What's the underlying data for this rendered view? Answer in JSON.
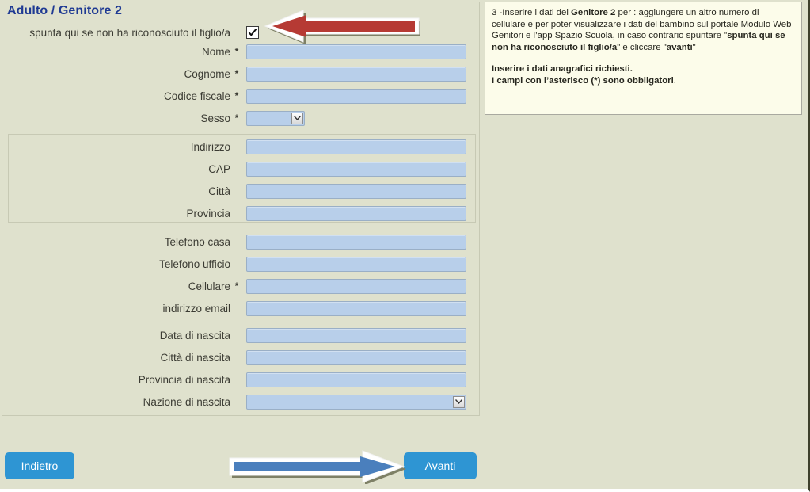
{
  "panel": {
    "title": "Adulto / Genitore 2",
    "checkbox_label": "spunta qui se non ha riconosciuto il figlio/a",
    "checkbox_checked": true,
    "required_marker": "*"
  },
  "fields": [
    {
      "label": "Nome",
      "required": true,
      "type": "text",
      "value": ""
    },
    {
      "label": "Cognome",
      "required": true,
      "type": "text",
      "value": ""
    },
    {
      "label": "Codice fiscale",
      "required": true,
      "type": "text",
      "value": ""
    },
    {
      "label": "Sesso",
      "required": true,
      "type": "select",
      "value": ""
    },
    {
      "label": "Indirizzo",
      "required": false,
      "type": "text",
      "value": ""
    },
    {
      "label": "CAP",
      "required": false,
      "type": "text",
      "value": ""
    },
    {
      "label": "Città",
      "required": false,
      "type": "text",
      "value": ""
    },
    {
      "label": "Provincia",
      "required": false,
      "type": "text",
      "value": ""
    },
    {
      "label": "Telefono casa",
      "required": false,
      "type": "text",
      "value": ""
    },
    {
      "label": "Telefono ufficio",
      "required": false,
      "type": "text",
      "value": ""
    },
    {
      "label": "Cellulare",
      "required": true,
      "type": "text",
      "value": ""
    },
    {
      "label": "indirizzo email",
      "required": false,
      "type": "text",
      "value": ""
    },
    {
      "label": "Data di nascita",
      "required": false,
      "type": "text",
      "value": ""
    },
    {
      "label": "Città di nascita",
      "required": false,
      "type": "text",
      "value": ""
    },
    {
      "label": "Provincia di nascita",
      "required": false,
      "type": "text",
      "value": ""
    },
    {
      "label": "Nazione di nascita",
      "required": false,
      "type": "select",
      "value": ""
    }
  ],
  "instructions": {
    "line1_prefix": "3  -Inserire i dati del ",
    "line1_bold": "Genitore 2",
    "line1_rest": " per : aggiungere un altro numero di cellulare e per poter visualizzare i dati del bambino sul portale Modulo Web Genitori",
    "line2_prefix": "    e l’app  Spazio Scuola, in caso contrario spuntare \"",
    "line2_bold": "spunta qui se non ha riconosciuto il figlio/a",
    "line2_mid": "\" e cliccare \"",
    "line2_bold2": "avanti",
    "line2_end": "\"",
    "para2_line1": "Inserire i dati anagrafici richiesti.",
    "para2_line2": "I campi con l’asterisco (*) sono obbligatori",
    "para2_line2_end": "."
  },
  "buttons": {
    "back": "Indietro",
    "next": "Avanti"
  },
  "annotations": {
    "red_arrow": "red-left-arrow-to-checkbox",
    "blue_arrow": "blue-right-arrow-to-avanti"
  },
  "colors": {
    "page_background": "#dfe1cd",
    "field_fill": "#b8cfea",
    "field_border": "#9aafc6",
    "title_text": "#1f3a93",
    "button_blue": "#2e95d3",
    "instruction_background": "#fcfcea",
    "red_arrow": "#b63a34",
    "blue_arrow": "#4a7fbd"
  }
}
